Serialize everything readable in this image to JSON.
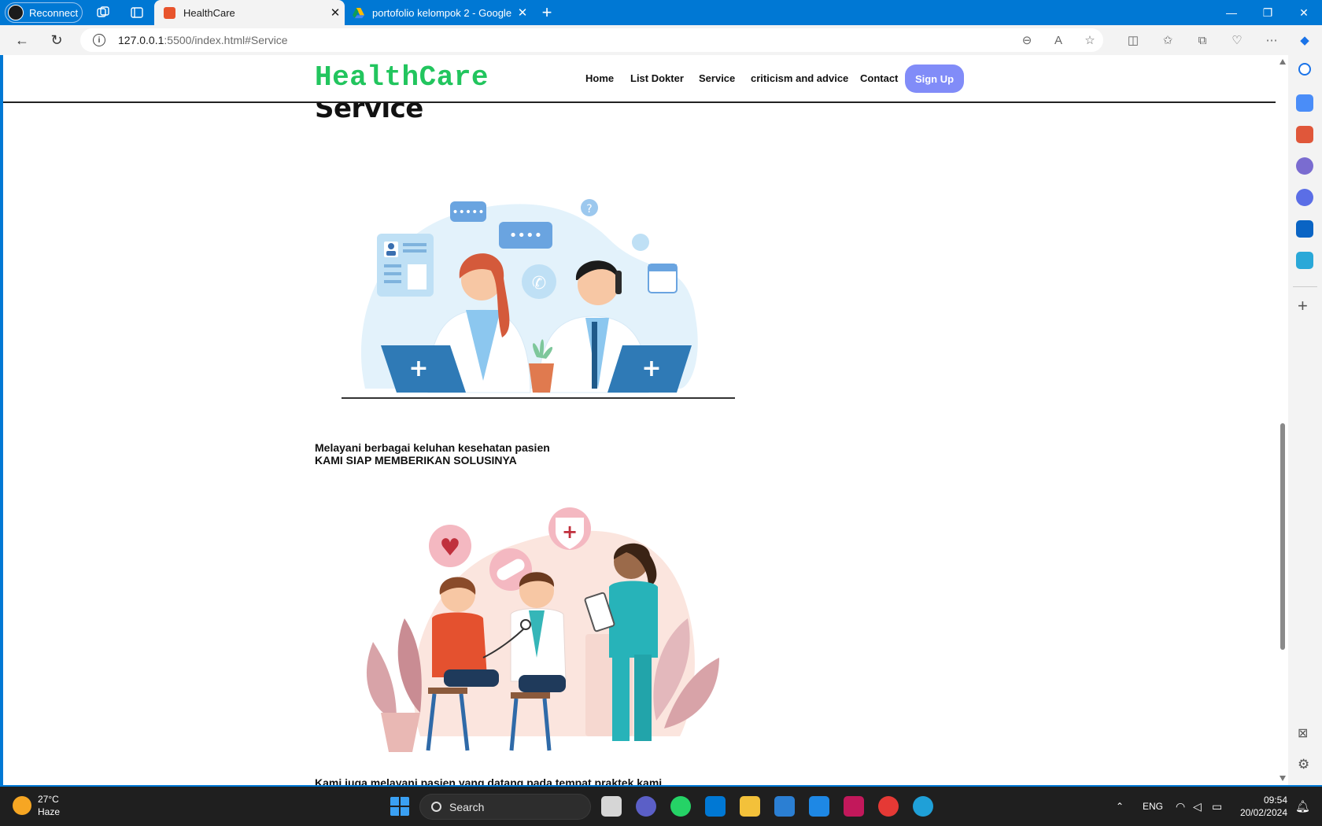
{
  "browser": {
    "reconnect_label": "Reconnect",
    "tabs": [
      {
        "title": "HealthCare",
        "active": true
      },
      {
        "title": "portofolio kelompok 2 - Google",
        "active": false
      }
    ],
    "url_host": "127.0.0.1",
    "url_path": ":5500/index.html#Service"
  },
  "site": {
    "logo": "HealthCare",
    "nav": {
      "home": "Home",
      "list_dokter": "List Dokter",
      "service": "Service",
      "criticism": "criticism and advice",
      "contact": "Contact",
      "signup": "Sign Up"
    },
    "section_title": "Service",
    "captions": {
      "first_line1": "Melayani berbagai keluhan kesehatan pasien",
      "first_line2": "KAMI SIAP MEMBERIKAN SOLUSINYA",
      "second_line1": "Kami juga melayani pasien yang datang pada tempat praktek kami"
    }
  },
  "taskbar": {
    "weather_temp": "27°C",
    "weather_desc": "Haze",
    "search_label": "Search",
    "lang": "ENG",
    "time": "09:54",
    "date": "20/02/2024"
  },
  "colors": {
    "brand_green": "#22c55e",
    "signup_bg": "#818cf8",
    "chrome_blue": "#0078d4"
  }
}
